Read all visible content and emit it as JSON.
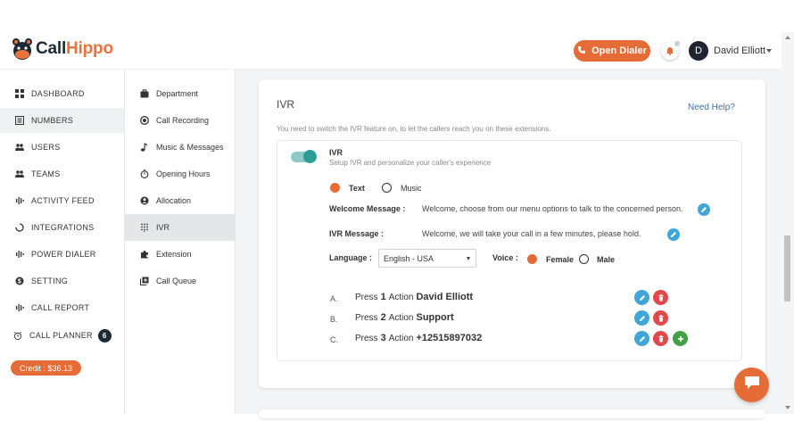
{
  "colors": {
    "brand": "#e56b37",
    "teal": "#2b9d94",
    "edit": "#42a5d8",
    "delete": "#e0484b",
    "add": "#43a047"
  },
  "header": {
    "logo_prefix": "Call",
    "logo_accent": "Hippo",
    "open_dialer": "Open Dialer",
    "avatar_initial": "D",
    "user_name": "David Elliott"
  },
  "sidebar": {
    "items": [
      {
        "label": "DASHBOARD",
        "icon": "dashboard-icon"
      },
      {
        "label": "NUMBERS",
        "icon": "numbers-icon"
      },
      {
        "label": "USERS",
        "icon": "users-icon"
      },
      {
        "label": "TEAMS",
        "icon": "teams-icon"
      },
      {
        "label": "ACTIVITY FEED",
        "icon": "activity-icon"
      },
      {
        "label": "INTEGRATIONS",
        "icon": "integrations-icon"
      },
      {
        "label": "POWER DIALER",
        "icon": "power-dialer-icon"
      },
      {
        "label": "SETTING",
        "icon": "setting-icon"
      },
      {
        "label": "CALL REPORT",
        "icon": "call-report-icon"
      },
      {
        "label": "CALL PLANNER",
        "icon": "alarm-clock-icon",
        "badge": "6"
      }
    ],
    "credit": "Credit : $36.13"
  },
  "submenu": {
    "items": [
      {
        "label": "Department",
        "icon": "briefcase-icon"
      },
      {
        "label": "Call Recording",
        "icon": "record-icon"
      },
      {
        "label": "Music & Messages",
        "icon": "music-icon"
      },
      {
        "label": "Opening Hours",
        "icon": "timer-icon"
      },
      {
        "label": "Allocation",
        "icon": "allocation-icon"
      },
      {
        "label": "IVR",
        "icon": "dialpad-icon"
      },
      {
        "label": "Extension",
        "icon": "puzzle-icon"
      },
      {
        "label": "Call Queue",
        "icon": "queue-icon"
      }
    ]
  },
  "ivr": {
    "title": "IVR",
    "need_help": "Need Help?",
    "description": "You need to switch the IVR feature on, to let the callers reach you on these extensions.",
    "toggle_label": "IVR",
    "toggle_sub": "Setup IVR and personalize your caller's experience",
    "enabled": true,
    "mode_text": "Text",
    "mode_music": "Music",
    "welcome_label": "Welcome Message :",
    "welcome_value": "Welcome, choose from our menu options to talk to the concerned person.",
    "ivr_message_label": "IVR Message :",
    "ivr_message_value": "Welcome, we will take your call in a few minutes, please hold.",
    "language_label": "Language :",
    "language_value": "English - USA",
    "voice_label": "Voice :",
    "voice_female": "Female",
    "voice_male": "Male",
    "options": [
      {
        "letter": "A.",
        "press": "Press",
        "digit": "1",
        "action": "Action",
        "target": "David Elliott"
      },
      {
        "letter": "B.",
        "press": "Press",
        "digit": "2",
        "action": "Action",
        "target": "Support"
      },
      {
        "letter": "C.",
        "press": "Press",
        "digit": "3",
        "action": "Action",
        "target": "+12515897032"
      }
    ]
  }
}
